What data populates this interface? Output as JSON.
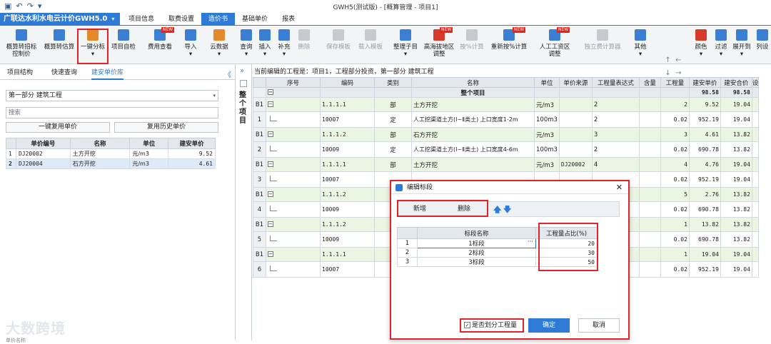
{
  "window": {
    "title": "GWH5(测试版) - [概算管理 - 项目1]",
    "quick_icons": [
      "save-icon",
      "undo-icon",
      "redo-icon",
      "dropdown-icon"
    ]
  },
  "app_name": "广联达水利水电云计价GWH5.0",
  "menu_tabs": [
    {
      "label": "项目信息",
      "active": false
    },
    {
      "label": "取费设置",
      "active": false
    },
    {
      "label": "造价书",
      "active": true
    },
    {
      "label": "基础单价",
      "active": false
    },
    {
      "label": "报表",
      "active": false
    }
  ],
  "toolbar": {
    "items": [
      {
        "label": "概算转招标\n控制价",
        "icon": "convert-icon",
        "state": "enabled"
      },
      {
        "label": "概算转估算",
        "icon": "convert-estimate-icon",
        "state": "enabled"
      },
      {
        "label": "一键分标\n▾",
        "icon": "split-bid-icon",
        "state": "enabled"
      },
      {
        "label": "项目自检",
        "icon": "self-check-icon",
        "state": "enabled"
      },
      {
        "label": "费用查看",
        "icon": "fee-view-icon",
        "state": "enabled",
        "badge": "NEW"
      },
      {
        "label": "导入\n▾",
        "icon": "import-icon",
        "state": "enabled"
      },
      {
        "label": "云数据\n▾",
        "icon": "cloud-data-icon",
        "state": "enabled"
      },
      {
        "label": "查询\n▾",
        "icon": "search-icon",
        "state": "enabled"
      },
      {
        "label": "插入\n▾",
        "icon": "insert-icon",
        "state": "enabled"
      },
      {
        "label": "补充\n▾",
        "icon": "supplement-icon",
        "state": "enabled"
      },
      {
        "label": "删除",
        "icon": "delete-icon",
        "state": "disabled"
      },
      {
        "label": "保存模板",
        "icon": "save-template-icon",
        "state": "disabled"
      },
      {
        "label": "载入模板",
        "icon": "load-template-icon",
        "state": "disabled"
      },
      {
        "label": "整理子目\n▾",
        "icon": "organize-icon",
        "state": "enabled"
      },
      {
        "label": "高海拔地区\n调整",
        "icon": "altitude-icon",
        "state": "enabled",
        "badge": "NEW"
      },
      {
        "label": "按%计算",
        "icon": "percent-icon",
        "state": "disabled"
      },
      {
        "label": "重新按%计算",
        "icon": "recalc-percent-icon",
        "state": "enabled",
        "badge": "NEW"
      },
      {
        "label": "人工工资区\n调整",
        "icon": "wage-icon",
        "state": "enabled",
        "badge": "NEW"
      },
      {
        "label": "独立费计算器",
        "icon": "calculator-icon",
        "state": "disabled"
      },
      {
        "label": "其他\n▾",
        "icon": "other-icon",
        "state": "enabled"
      },
      {
        "label": "颜色\n▾",
        "icon": "color-icon",
        "state": "enabled"
      },
      {
        "label": "过滤\n▾",
        "icon": "filter-icon",
        "state": "enabled"
      },
      {
        "label": "展开到\n▾",
        "icon": "expand-icon",
        "state": "enabled"
      },
      {
        "label": "列设",
        "icon": "column-settings-icon",
        "state": "enabled"
      }
    ],
    "move_arrows": [
      "↑",
      "←",
      "↓",
      "→"
    ]
  },
  "left_panel": {
    "tabs": [
      {
        "label": "项目结构",
        "active": false
      },
      {
        "label": "快速查询",
        "active": false
      },
      {
        "label": "建安单价库",
        "active": true
      }
    ],
    "collapse_glyph": "《",
    "section_select": "第一部分  建筑工程",
    "search_placeholder": "搜索",
    "buttons": {
      "reuse": "一键复用单价",
      "history": "复用历史单价"
    },
    "table": {
      "headers": [
        "",
        "单价编号",
        "名称",
        "单位",
        "建安单价"
      ],
      "rows": [
        {
          "n": "1",
          "code": "DJ20002",
          "name": "土方开挖",
          "unit": "元/m3",
          "price": "9.52"
        },
        {
          "n": "2",
          "code": "DJ20004",
          "name": "石方开挖",
          "unit": "元/m3",
          "price": "4.61"
        }
      ]
    }
  },
  "vstrip": {
    "expand_glyph": "»",
    "label": "整个项目"
  },
  "current_info": "当前编辑的工程是：项目1，工程部分投资，第一部分 建筑工程",
  "grid": {
    "headers": [
      "",
      "序号",
      "编码",
      "类别",
      "名称",
      "单位",
      "单价来源",
      "工程量表达式",
      "含量",
      "工程量",
      "建安单价",
      "建安合价",
      "设"
    ],
    "root": {
      "name": "整个项目",
      "price": "98.58",
      "total": "98.58"
    },
    "rows": [
      {
        "kind": "part",
        "rownum": "B1",
        "code": "1.1.1.1",
        "cat": "部",
        "name": "土方开挖",
        "unit": "元/m3",
        "src": "",
        "expr": "2",
        "content": "",
        "qty": "2",
        "price": "9.52",
        "total": "19.04"
      },
      {
        "kind": "quota",
        "rownum": "1",
        "code": "10007",
        "cat": "定",
        "name": "人工挖渠道土方(Ⅰ~Ⅱ类土) 上口宽度1-2m",
        "unit": "100m3",
        "src": "",
        "expr": "2",
        "content": "",
        "qty": "0.02",
        "price": "952.19",
        "total": "19.04"
      },
      {
        "kind": "part",
        "rownum": "B1",
        "code": "1.1.1.2",
        "cat": "部",
        "name": "石方开挖",
        "unit": "元/m3",
        "src": "",
        "expr": "3",
        "content": "",
        "qty": "3",
        "price": "4.61",
        "total": "13.82"
      },
      {
        "kind": "quota",
        "rownum": "2",
        "code": "10009",
        "cat": "定",
        "name": "人工挖渠道土方(Ⅰ~Ⅱ类土) 上口宽度4-6m",
        "unit": "100m3",
        "src": "",
        "expr": "2",
        "content": "",
        "qty": "0.02",
        "price": "690.78",
        "total": "13.82"
      },
      {
        "kind": "part",
        "rownum": "B1",
        "code": "1.1.1.1",
        "cat": "部",
        "name": "土方开挖",
        "unit": "元/m3",
        "src": "DJ20002",
        "expr": "4",
        "content": "",
        "qty": "4",
        "price": "4.76",
        "total": "19.04"
      },
      {
        "kind": "quota",
        "rownum": "3",
        "code": "10007",
        "cat": "",
        "name": "",
        "unit": "",
        "src": "",
        "expr": "",
        "content": "",
        "qty": "0.02",
        "price": "952.19",
        "total": "19.04"
      },
      {
        "kind": "part",
        "rownum": "B1",
        "code": "1.1.1.2",
        "cat": "",
        "name": "",
        "unit": "",
        "src": "",
        "expr": "",
        "content": "",
        "qty": "5",
        "price": "2.76",
        "total": "13.82"
      },
      {
        "kind": "quota",
        "rownum": "4",
        "code": "10009",
        "cat": "",
        "name": "",
        "unit": "",
        "src": "",
        "expr": "",
        "content": "",
        "qty": "0.02",
        "price": "690.78",
        "total": "13.82"
      },
      {
        "kind": "part",
        "rownum": "B1",
        "code": "1.1.1.2",
        "cat": "",
        "name": "",
        "unit": "",
        "src": "",
        "expr": "",
        "content": "",
        "qty": "1",
        "price": "13.82",
        "total": "13.82"
      },
      {
        "kind": "quota",
        "rownum": "5",
        "code": "10009",
        "cat": "",
        "name": "",
        "unit": "",
        "src": "",
        "expr": "",
        "content": "",
        "qty": "0.02",
        "price": "690.78",
        "total": "13.82"
      },
      {
        "kind": "part",
        "rownum": "B1",
        "code": "1.1.1.1",
        "cat": "",
        "name": "",
        "unit": "",
        "src": "",
        "expr": "",
        "content": "",
        "qty": "1",
        "price": "19.04",
        "total": "19.04"
      },
      {
        "kind": "quota",
        "rownum": "6",
        "code": "10007",
        "cat": "",
        "name": "",
        "unit": "",
        "src": "",
        "expr": "",
        "content": "",
        "qty": "0.02",
        "price": "952.19",
        "total": "19.04"
      }
    ]
  },
  "dialog": {
    "title": "编辑标段",
    "close_glyph": "✕",
    "add_label": "新增",
    "delete_label": "删除",
    "up_glyph": "🡅",
    "down_glyph": "🡇",
    "headers": [
      "",
      "标段名称",
      "工程量占比(%)"
    ],
    "rows": [
      {
        "n": "1",
        "name": "1标段",
        "ratio": "20"
      },
      {
        "n": "2",
        "name": "2标段",
        "ratio": "30"
      },
      {
        "n": "3",
        "name": "3标段",
        "ratio": "50"
      }
    ],
    "edit_ellipsis": "···",
    "checkbox_label": "是否划分工程量",
    "checkbox_mark": "✓",
    "ok_label": "确定",
    "cancel_label": "取消"
  },
  "watermark": "大数跨境",
  "bottom_edge_text": "单价名称",
  "colors": {
    "accent": "#2d7bd6",
    "highlight_red": "#e0242a",
    "part_row": "#eaf5e2"
  }
}
